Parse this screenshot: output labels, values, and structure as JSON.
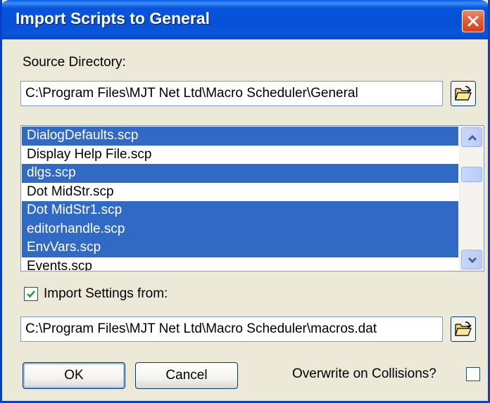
{
  "window": {
    "title": "Import Scripts to General"
  },
  "source": {
    "label": "Source Directory:",
    "path": "C:\\Program Files\\MJT Net Ltd\\Macro Scheduler\\General"
  },
  "files": [
    {
      "name": "DialogDefaults.scp",
      "selected": true
    },
    {
      "name": "Display Help File.scp",
      "selected": false
    },
    {
      "name": "dlgs.scp",
      "selected": true
    },
    {
      "name": "Dot MidStr.scp",
      "selected": false
    },
    {
      "name": "Dot MidStr1.scp",
      "selected": true
    },
    {
      "name": "editorhandle.scp",
      "selected": true
    },
    {
      "name": "EnvVars.scp",
      "selected": true
    },
    {
      "name": "Events.scp",
      "selected": false
    }
  ],
  "import_settings": {
    "label": "Import Settings from:",
    "checked": true,
    "path": "C:\\Program Files\\MJT Net Ltd\\Macro Scheduler\\macros.dat"
  },
  "buttons": {
    "ok": "OK",
    "cancel": "Cancel"
  },
  "overwrite": {
    "label": "Overwrite on Collisions?",
    "checked": false
  },
  "icons": {
    "close": "close-icon",
    "folder": "open-folder-icon",
    "scroll_up": "chevron-up-icon",
    "scroll_down": "chevron-down-icon",
    "check": "checkmark-icon"
  },
  "colors": {
    "titlebar": "#0650d6",
    "selection": "#316ac5",
    "close_button": "#d2431b",
    "dialog_background": "#ece9d8"
  }
}
